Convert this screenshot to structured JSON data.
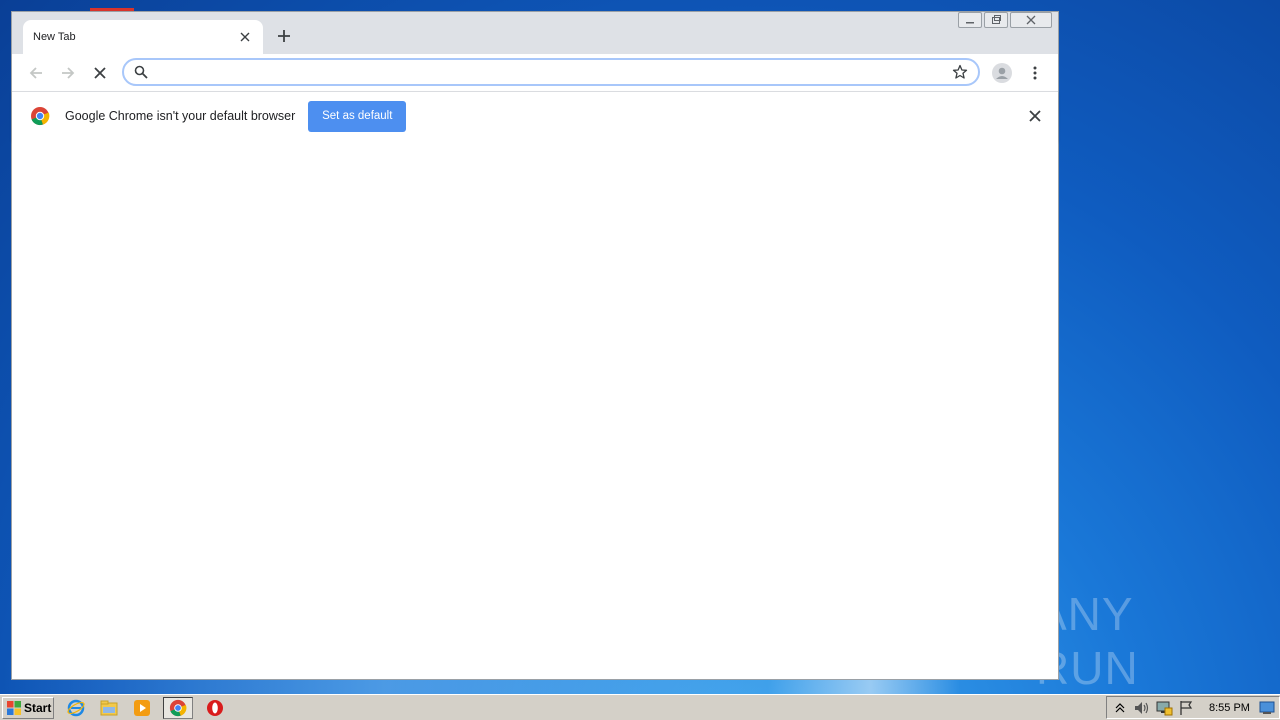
{
  "browser": {
    "tab": {
      "title": "New Tab"
    },
    "omnibox": {
      "value": "",
      "placeholder": ""
    },
    "infobar": {
      "message": "Google Chrome isn't your default browser",
      "button_label": "Set as default"
    }
  },
  "watermark": {
    "text": "ANY RUN"
  },
  "taskbar": {
    "start_label": "Start",
    "clock": "8:55 PM"
  },
  "colors": {
    "accent": "#4d8ff0",
    "omnibox_border": "#a8c7fa",
    "desktop": "#1a78d8"
  },
  "icons": [
    "back-icon",
    "forward-icon",
    "stop-icon",
    "search-icon",
    "star-icon",
    "profile-icon",
    "menu-icon",
    "chrome-icon",
    "close-icon",
    "plus-icon"
  ]
}
